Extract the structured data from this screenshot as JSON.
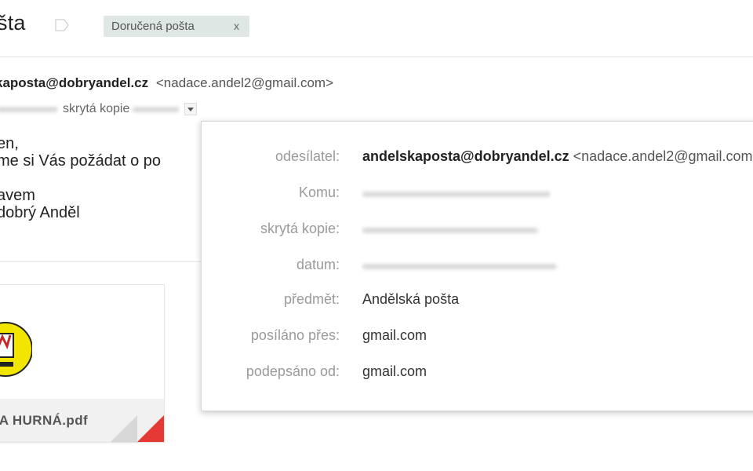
{
  "header": {
    "subject": "šta",
    "label_chip": {
      "text": "Doručená pošta",
      "close": "x"
    }
  },
  "message": {
    "sender_name": "kaposta@dobryandel.cz",
    "sender_address": "<nadace.andel2@gmail.com>",
    "bcc_label": "skrytá kopie",
    "body_lines": [
      "en,",
      "me si Vás požádat o po",
      "avem",
      "dobrý Anděl"
    ]
  },
  "attachment": {
    "filename": "ŠA HURNÁ.pdf"
  },
  "details": {
    "rows": [
      {
        "label": "odesílatel:",
        "value": "andelskaposta@dobryandel.cz",
        "extra": "<nadace.andel2@gmail.com>"
      },
      {
        "label": "Komu:",
        "value": ""
      },
      {
        "label": "skrytá kopie:",
        "value": ""
      },
      {
        "label": "datum:",
        "value": ""
      },
      {
        "label": "předmět:",
        "value": "Andělská pošta"
      },
      {
        "label": "posíláno přes:",
        "value": "gmail.com"
      },
      {
        "label": "podepsáno od:",
        "value": "gmail.com"
      }
    ]
  },
  "colors": {
    "label_chip_bg": "#dfe7e4",
    "pdf_badge": "#e53935",
    "muted_label": "#9a9a9a"
  }
}
